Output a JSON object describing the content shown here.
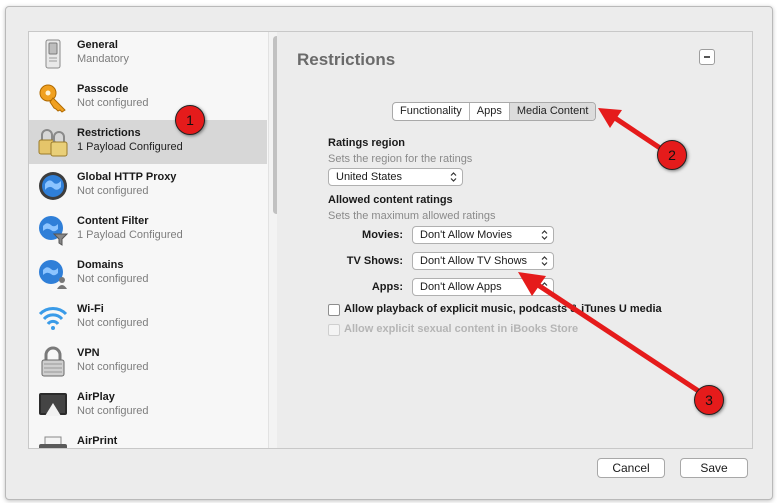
{
  "sidebar": {
    "items": [
      {
        "title": "General",
        "subtitle": "Mandatory",
        "icon": "general-switch-icon"
      },
      {
        "title": "Passcode",
        "subtitle": "Not configured",
        "icon": "key-icon"
      },
      {
        "title": "Restrictions",
        "subtitle": "1 Payload Configured",
        "icon": "padlocks-icon",
        "selected": true
      },
      {
        "title": "Global HTTP Proxy",
        "subtitle": "Not configured",
        "icon": "globe-proxy-icon"
      },
      {
        "title": "Content Filter",
        "subtitle": "1 Payload Configured",
        "icon": "globe-filter-icon"
      },
      {
        "title": "Domains",
        "subtitle": "Not configured",
        "icon": "globe-person-icon"
      },
      {
        "title": "Wi-Fi",
        "subtitle": "Not configured",
        "icon": "wifi-icon"
      },
      {
        "title": "VPN",
        "subtitle": "Not configured",
        "icon": "lock-icon"
      },
      {
        "title": "AirPlay",
        "subtitle": "Not configured",
        "icon": "airplay-icon"
      },
      {
        "title": "AirPrint",
        "subtitle": "",
        "icon": "printer-icon"
      }
    ]
  },
  "panel": {
    "title": "Restrictions",
    "tabs": [
      {
        "label": "Functionality",
        "active": false
      },
      {
        "label": "Apps",
        "active": false
      },
      {
        "label": "Media Content",
        "active": true
      }
    ],
    "ratings_region": {
      "label": "Ratings region",
      "hint": "Sets the region for the ratings",
      "value": "United States"
    },
    "allowed_ratings": {
      "label": "Allowed content ratings",
      "hint": "Sets the maximum allowed ratings",
      "rows": [
        {
          "label": "Movies:",
          "value": "Don't Allow Movies"
        },
        {
          "label": "TV Shows:",
          "value": "Don't Allow TV Shows"
        },
        {
          "label": "Apps:",
          "value": "Don't Allow Apps"
        }
      ]
    },
    "checkboxes": [
      {
        "label": "Allow playback of explicit music, podcasts & iTunes U media",
        "checked": false,
        "enabled": true
      },
      {
        "label": "Allow explicit sexual content in iBooks Store",
        "checked": false,
        "enabled": false
      }
    ]
  },
  "footer": {
    "cancel_label": "Cancel",
    "save_label": "Save"
  },
  "annotations": {
    "badges": [
      "1",
      "2",
      "3"
    ],
    "color": "#e51b1b"
  }
}
